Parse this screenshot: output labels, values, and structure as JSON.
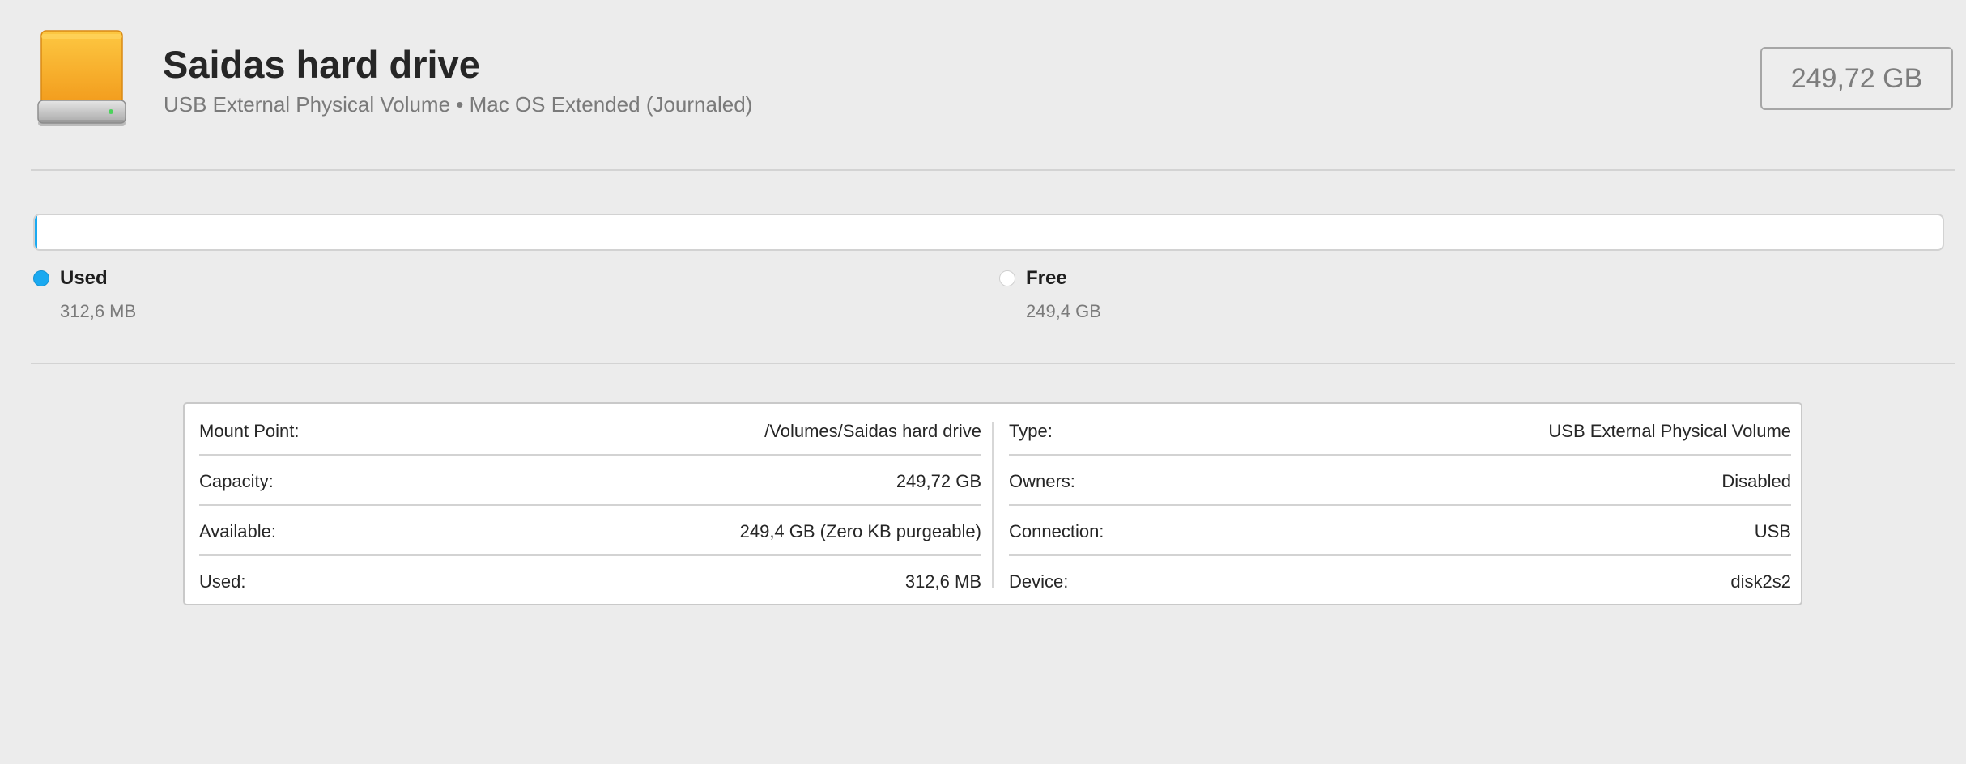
{
  "drive": {
    "name": "Saidas hard drive",
    "subtitle": "USB External Physical Volume • Mac OS Extended (Journaled)",
    "capacity_badge": "249,72 GB",
    "icon": "external-drive-icon"
  },
  "usage": {
    "used_fraction": 0.0013,
    "legend": [
      {
        "label": "Used",
        "value": "312,6 MB",
        "color": "#1aa9f0"
      },
      {
        "label": "Free",
        "value": "249,4 GB",
        "color": "#ffffff"
      }
    ]
  },
  "info": {
    "left": [
      {
        "key": "Mount Point:",
        "value": "/Volumes/Saidas hard drive"
      },
      {
        "key": "Capacity:",
        "value": "249,72 GB"
      },
      {
        "key": "Available:",
        "value": "249,4 GB (Zero KB purgeable)"
      },
      {
        "key": "Used:",
        "value": "312,6 MB"
      }
    ],
    "right": [
      {
        "key": "Type:",
        "value": "USB External Physical Volume"
      },
      {
        "key": "Owners:",
        "value": "Disabled"
      },
      {
        "key": "Connection:",
        "value": "USB"
      },
      {
        "key": "Device:",
        "value": "disk2s2"
      }
    ]
  },
  "colors": {
    "accent": "#1aa9f0",
    "drive_orange": "#f5a623",
    "background": "#ececec"
  }
}
